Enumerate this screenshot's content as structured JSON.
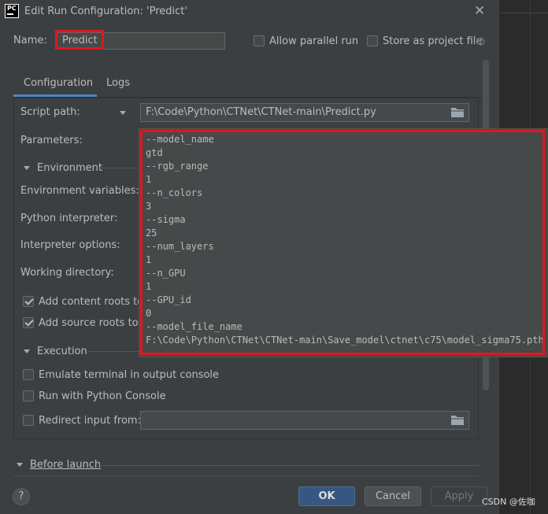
{
  "window": {
    "title": "Edit Run Configuration: 'Predict'",
    "app_icon_text": "PC"
  },
  "header": {
    "name_label": "Name:",
    "name_value": "Predict",
    "allow_parallel_label": "Allow parallel run",
    "allow_parallel_checked": false,
    "store_project_label": "Store as project file",
    "store_project_checked": false
  },
  "tabs": [
    {
      "label": "Configuration",
      "active": true
    },
    {
      "label": "Logs",
      "active": false
    }
  ],
  "config": {
    "script_path_label": "Script path:",
    "script_path_value": "F:\\Code\\Python\\CTNet\\CTNet-main\\Predict.py",
    "parameters_label": "Parameters:",
    "environment_section": "Environment",
    "env_vars_label": "Environment variables:",
    "python_interpreter_label": "Python interpreter:",
    "interpreter_options_label": "Interpreter options:",
    "working_dir_label": "Working directory:",
    "add_content_roots_label": "Add content roots to",
    "add_content_roots_checked": true,
    "add_source_roots_label": "Add source roots to P",
    "add_source_roots_checked": true,
    "execution_section": "Execution",
    "emulate_terminal_label": "Emulate terminal in output console",
    "emulate_terminal_checked": false,
    "python_console_label": "Run with Python Console",
    "python_console_checked": false,
    "redirect_input_label": "Redirect input from:",
    "redirect_input_checked": false,
    "redirect_input_value": ""
  },
  "parameters_popup": {
    "lines": [
      "--model_name",
      "gtd",
      "--rgb_range",
      "1",
      "--n_colors",
      "3",
      "--sigma",
      "25",
      "--num_layers",
      "1",
      "--n_GPU",
      "1",
      "--GPU_id",
      "0",
      "--model_file_name",
      "F:\\Code\\Python\\CTNet\\CTNet-main\\Save_model\\ctnet\\c75\\model_sigma75.pth"
    ]
  },
  "before_launch": {
    "label": "Before launch"
  },
  "buttons": {
    "help": "?",
    "ok": "OK",
    "cancel": "Cancel",
    "apply": "Apply"
  },
  "watermark": "CSDN @佐咖",
  "colors": {
    "dialog_bg": "#3c3f41",
    "field_bg": "#45494a",
    "highlight_red": "#e1171d",
    "tab_accent": "#4a88c7",
    "ok_button": "#365880"
  }
}
